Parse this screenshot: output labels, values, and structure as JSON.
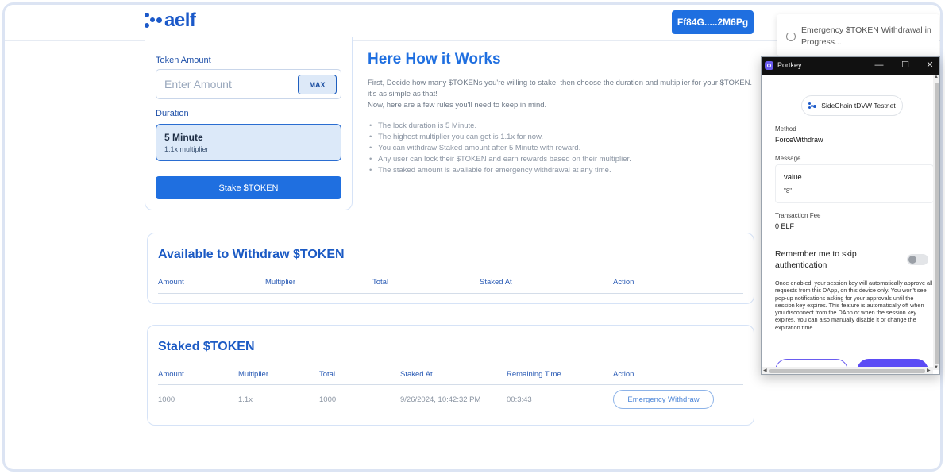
{
  "header": {
    "logo_text": "aelf",
    "wallet_address": "Ff84G.....2M6Pg"
  },
  "stake_form": {
    "token_amount_label": "Token Amount",
    "amount_placeholder": "Enter Amount",
    "amount_value": "",
    "max_label": "MAX",
    "duration_label": "Duration",
    "duration_title": "5 Minute",
    "duration_multiplier": "1.1x multiplier",
    "stake_button": "Stake $TOKEN"
  },
  "how_it_works": {
    "title": "Here How it Works",
    "intro_1": "First, Decide how many $TOKENs you're willing to stake, then choose the duration and multiplier for your $TOKEN. it's as simple as that!",
    "intro_2": "Now, here are a few rules you'll need to keep in mind.",
    "rules": [
      "The lock duration is 5 Minute.",
      "The highest multiplier you can get is 1.1x for now.",
      "You can withdraw Staked amount after 5 Minute with reward.",
      "Any user can lock their $TOKEN and earn rewards based on their multiplier.",
      "The staked amount is available for emergency withdrawal at any time."
    ]
  },
  "available_withdraw": {
    "title": "Available to Withdraw $TOKEN",
    "columns": [
      "Amount",
      "Multiplier",
      "Total",
      "Staked At",
      "Action"
    ],
    "rows": []
  },
  "staked": {
    "title": "Staked $TOKEN",
    "columns": [
      "Amount",
      "Multiplier",
      "Total",
      "Staked At",
      "Remaining Time",
      "Action"
    ],
    "rows": [
      {
        "amount": "1000",
        "multiplier": "1.1x",
        "total": "1000",
        "staked_at": "9/26/2024, 10:42:32 PM",
        "remaining_time": "00:3:43",
        "action": "Emergency Withdraw"
      }
    ]
  },
  "toast": {
    "message": "Emergency $TOKEN Withdrawal in Progress..."
  },
  "portkey_popup": {
    "window_title": "Portkey",
    "chain": "SideChain tDVW Testnet",
    "method_label": "Method",
    "method_value": "ForceWithdraw",
    "message_label": "Message",
    "message_key": "value",
    "message_value": "\"8\"",
    "fee_label": "Transaction Fee",
    "fee_value": "0 ELF",
    "remember_label": "Remember me to skip authentication",
    "remember_enabled": false,
    "note": "Once enabled, your session key will automatically approve all requests from this DApp, on this device only. You won't see pop-up notifications asking for your approvals until the session key expires. This feature is automatically off when you disconnect from the DApp or when the session key expires. You can also manually disable it or change the expiration time.",
    "window_controls": {
      "minimize": "—",
      "maximize": "☐",
      "close": "✕"
    }
  },
  "colors": {
    "primary": "#1f6fe0",
    "heading": "#1b5ac4",
    "portkey_purple": "#5b4bf5"
  }
}
